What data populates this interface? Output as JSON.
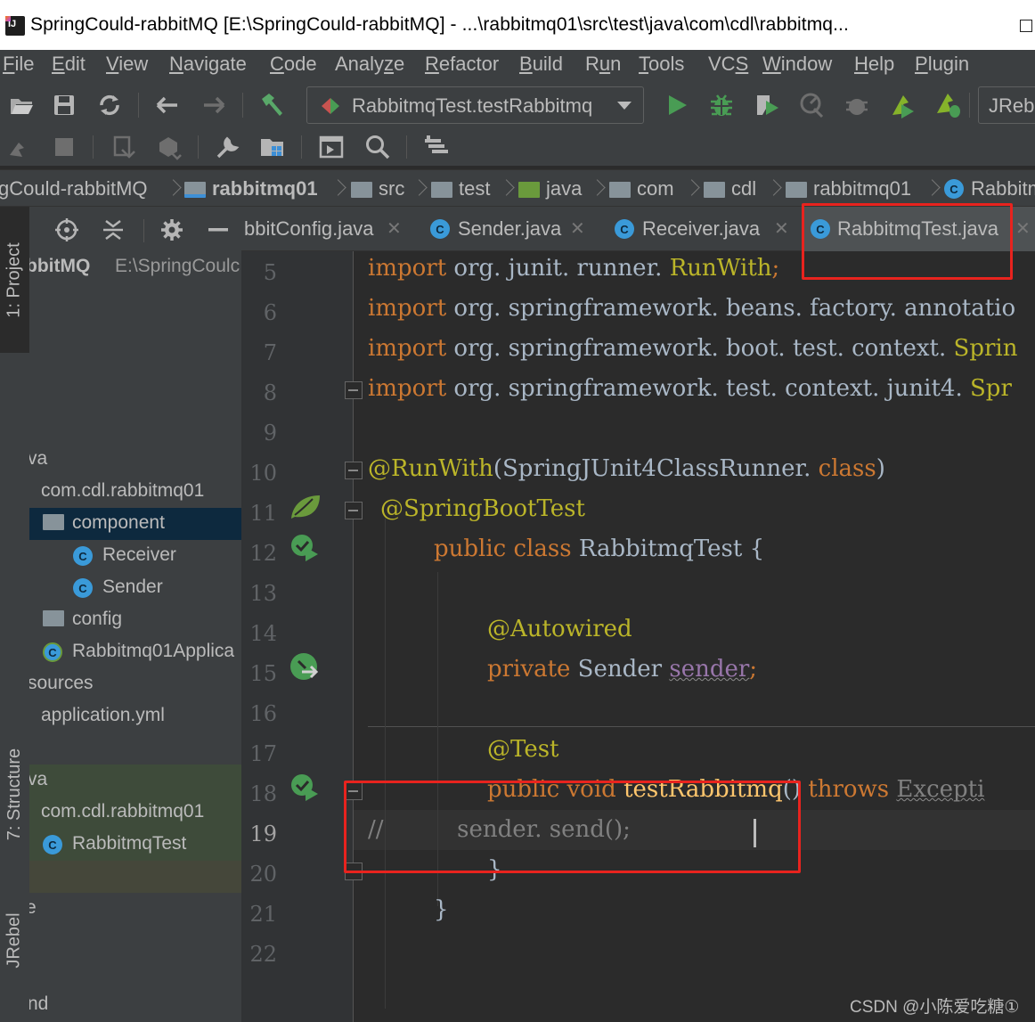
{
  "window": {
    "title": "SpringCould-rabbitMQ [E:\\SpringCould-rabbitMQ] - ...\\rabbitmq01\\src\\test\\java\\com\\cdl\\rabbitmq..."
  },
  "menu": [
    {
      "label": "File",
      "u": "F",
      "rest": "ile"
    },
    {
      "label": "Edit",
      "u": "E",
      "rest": "dit"
    },
    {
      "label": "View",
      "u": "V",
      "rest": "iew"
    },
    {
      "label": "Navigate",
      "u": "N",
      "rest": "avigate"
    },
    {
      "label": "Code",
      "u": "C",
      "rest": "ode"
    },
    {
      "label": "Analyze",
      "pre": "Analy",
      "u": "z",
      "rest": "e"
    },
    {
      "label": "Refactor",
      "u": "R",
      "rest": "efactor"
    },
    {
      "label": "Build",
      "u": "B",
      "rest": "uild"
    },
    {
      "label": "Run",
      "pre": "R",
      "u": "u",
      "rest": "n"
    },
    {
      "label": "Tools",
      "u": "T",
      "rest": "ools"
    },
    {
      "label": "VCS",
      "pre": "VC",
      "u": "S",
      "rest": ""
    },
    {
      "label": "Window",
      "u": "W",
      "rest": "indow"
    },
    {
      "label": "Help",
      "u": "H",
      "rest": "elp"
    },
    {
      "label": "Plugin",
      "u": "P",
      "rest": "lugin"
    }
  ],
  "toolbar": {
    "run_config": "RabbitmqTest.testRabbitmq",
    "jrebel_label": "JRebe"
  },
  "breadcrumb": [
    "gCould-rabbitMQ",
    "rabbitmq01",
    "src",
    "test",
    "java",
    "com",
    "cdl",
    "rabbitmq01",
    "Rabbitm"
  ],
  "left_stripe": {
    "project_tab": "1: Project",
    "structure_tab": "7: Structure",
    "jrebel_tab": "JRebel"
  },
  "project_panel": {
    "root_name": "bbitMQ",
    "root_path": "E:\\SpringCoulc",
    "rows": {
      "java_main": "va",
      "pkg_main": "com.cdl.rabbitmq01",
      "component": "component",
      "receiver": "Receiver",
      "sender": "Sender",
      "config": "config",
      "app": "Rabbitmq01Applica",
      "resources": "sources",
      "yml": "application.yml",
      "java_test": "va",
      "pkg_test": "com.cdl.rabbitmq01",
      "test_class": "RabbitmqTest",
      "e_row": "e",
      "nd_row": "nd"
    }
  },
  "editor_tabs": [
    {
      "label": "bbitConfig.java",
      "active": false
    },
    {
      "label": "Sender.java",
      "active": false
    },
    {
      "label": "Receiver.java",
      "active": false
    },
    {
      "label": "RabbitmqTest.java",
      "active": true
    }
  ],
  "line_numbers": [
    "5",
    "6",
    "7",
    "8",
    "9",
    "10",
    "11",
    "12",
    "13",
    "14",
    "15",
    "16",
    "17",
    "18",
    "19",
    "20",
    "21",
    "22"
  ],
  "current_line": "19",
  "code": {
    "l5_kw": "import",
    "l5_a": " org. junit. runner. ",
    "l5_b": "RunWith",
    "l5_c": ";",
    "l6_kw": "import",
    "l6_a": " org. springframework. beans. factory. annotatio",
    "l7_kw": "import",
    "l7_a": " org. springframework. boot. test. context. ",
    "l7_b": "Sprin",
    "l8_kw": "import",
    "l8_a": " org. springframework. test. context. junit4. ",
    "l8_b": "Spr",
    "l10_ann": "@RunWith",
    "l10_a": "(SpringJUnit4ClassRunner. ",
    "l10_kw": "class",
    "l10_b": ")",
    "l11_ann": "@SpringBootTest",
    "l12_kw": "public class",
    "l12_a": " RabbitmqTest {",
    "l14_ann": "@Autowired",
    "l15_kw": "private",
    "l15_a": " Sender ",
    "l15_fld": "sender",
    "l15_b": ";",
    "l17_ann": "@Test",
    "l18_kw": "public void",
    "l18_a": " ",
    "l18_m": "testRabbitmq",
    "l18_b": "() ",
    "l18_kw2": "throws",
    "l18_c": " ",
    "l18_ex": "Excepti",
    "l19_cm": "//          sender. send();",
    "l20": "}",
    "l21": "}"
  },
  "watermark": "CSDN @小陈爱吃糖①",
  "colors": {
    "highlight_box": "#e8231e",
    "keyword": "#cc7832",
    "annotation": "#bbb529",
    "comment": "#808080",
    "editor_bg": "#2b2b2b",
    "panel_bg": "#3c3f41"
  }
}
